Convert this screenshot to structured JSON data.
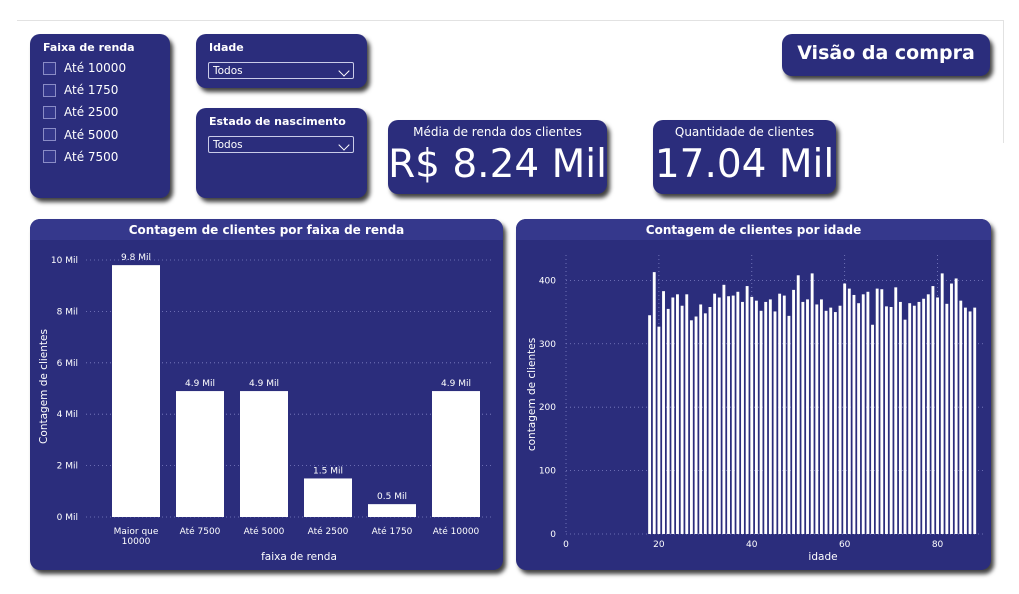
{
  "filters": {
    "faixa": {
      "title": "Faixa de renda",
      "options": [
        "Até 10000",
        "Até 1750",
        "Até 2500",
        "Até 5000",
        "Até 7500"
      ]
    },
    "idade": {
      "title": "Idade",
      "value": "Todos"
    },
    "estado": {
      "title": "Estado de nascimento",
      "value": "Todos"
    }
  },
  "page_title": "Visão da compra",
  "kpis": {
    "renda": {
      "label": "Média de renda dos clientes",
      "value": "R$ 8.24 Mil"
    },
    "clientes": {
      "label": "Quantidade de clientes",
      "value": "17.04 Mil"
    }
  },
  "colors": {
    "card": "#2b2d7c",
    "header": "#35388c",
    "bar": "#ffffff"
  },
  "chart_data": [
    {
      "type": "bar",
      "title": "Contagem de clientes por faixa de renda",
      "xlabel": "faixa de renda",
      "ylabel": "Contagem de clientes",
      "categories": [
        "Maior que 10000",
        "Até 7500",
        "Até 5000",
        "Até 2500",
        "Até 1750",
        "Até 10000"
      ],
      "category_lines": [
        [
          "Maior que",
          "10000"
        ],
        [
          "Até 7500"
        ],
        [
          "Até 5000"
        ],
        [
          "Até 2500"
        ],
        [
          "Até 1750"
        ],
        [
          "Até 10000"
        ]
      ],
      "values": [
        9.8,
        4.9,
        4.9,
        1.5,
        0.5,
        4.9
      ],
      "data_labels": [
        "9.8 Mil",
        "4.9 Mil",
        "4.9 Mil",
        "1.5 Mil",
        "0.5 Mil",
        "4.9 Mil"
      ],
      "yticks": [
        0,
        2,
        4,
        6,
        8,
        10
      ],
      "ytick_labels": [
        "0 Mil",
        "2 Mil",
        "4 Mil",
        "6 Mil",
        "8 Mil",
        "10 Mil"
      ],
      "ylim": [
        0,
        10
      ],
      "grid": true
    },
    {
      "type": "bar",
      "title": "Contagem de clientes por idade",
      "xlabel": "idade",
      "ylabel": "contagem de clientes",
      "x": [
        18,
        19,
        20,
        21,
        22,
        23,
        24,
        25,
        26,
        27,
        28,
        29,
        30,
        31,
        32,
        33,
        34,
        35,
        36,
        37,
        38,
        39,
        40,
        41,
        42,
        43,
        44,
        45,
        46,
        47,
        48,
        49,
        50,
        51,
        52,
        53,
        54,
        55,
        56,
        57,
        58,
        59,
        60,
        61,
        62,
        63,
        64,
        65,
        66,
        67,
        68,
        69,
        70,
        71,
        72,
        73,
        74,
        75,
        76,
        77,
        78,
        79,
        80,
        81,
        82,
        83,
        84,
        85,
        86,
        87,
        88
      ],
      "values": [
        345,
        413,
        327,
        383,
        355,
        373,
        378,
        360,
        378,
        337,
        343,
        362,
        348,
        358,
        379,
        373,
        393,
        375,
        376,
        382,
        366,
        391,
        374,
        368,
        352,
        366,
        370,
        351,
        379,
        376,
        344,
        385,
        408,
        366,
        370,
        411,
        362,
        370,
        352,
        357,
        350,
        360,
        395,
        387,
        377,
        364,
        378,
        382,
        330,
        387,
        386,
        359,
        358,
        389,
        366,
        338,
        364,
        360,
        366,
        371,
        378,
        391,
        373,
        411,
        363,
        395,
        403,
        368,
        357,
        351,
        357
      ],
      "xticks": [
        0,
        20,
        40,
        60,
        80
      ],
      "yticks": [
        0,
        100,
        200,
        300,
        400
      ],
      "xlim": [
        0,
        90
      ],
      "ylim": [
        0,
        440
      ],
      "grid": true
    }
  ]
}
